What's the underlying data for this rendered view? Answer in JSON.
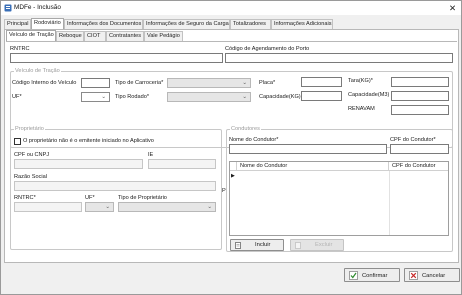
{
  "window": {
    "title": "MDFe - Inclusão",
    "close_glyph": "✕",
    "icon": "app-icon"
  },
  "main_tabs": [
    {
      "label": "Principal"
    },
    {
      "label": "Rodoviário"
    },
    {
      "label": "Informações dos Documentos"
    },
    {
      "label": "Informações de Seguro da Carga"
    },
    {
      "label": "Totalizadores"
    },
    {
      "label": "Informações Adicionais"
    }
  ],
  "sub_tabs": [
    {
      "label": "Veículo de Tração"
    },
    {
      "label": "Reboque"
    },
    {
      "label": "CIOT"
    },
    {
      "label": "Contratantes"
    },
    {
      "label": "Vale Pedágio"
    }
  ],
  "top_fields": {
    "rntrc": "RNTRC",
    "codigo_agendamento": "Código de Agendamento do Porto"
  },
  "veiculo_tracao": {
    "title": "Veículo de Tração",
    "codigo_interno": "Código Interno do Veículo",
    "tipo_carroceria": "Tipo de Carroceria*",
    "placa": "Placa*",
    "tara": "Tara(KG)*",
    "uf": "UF*",
    "tipo_rodado": "Tipo Rodado*",
    "capacidade_kg": "Capacidade(KG)",
    "capacidade_m3": "Capacidade(M3)",
    "renavam": "RENAVAM"
  },
  "proprietario": {
    "title": "Proprietário",
    "checkbox_label": "O proprietário não é o emitente iniciado no Aplicativo",
    "cpf_cnpj": "CPF ou CNPJ",
    "ie": "IE",
    "razao_social": "Razão Social",
    "rntrc": "RNTRC*",
    "uf": "UF*",
    "tipo_proprietario": "Tipo de Proprietário",
    "edge_mark": "P"
  },
  "condutores": {
    "title": "Condutores",
    "nome_condutor": "Nome do Condutor*",
    "cpf_condutor": "CPF do Condutor*",
    "grid_headers": [
      "Nome do Condutor",
      "CPF do Condutor"
    ],
    "row_indicator": "▶",
    "incluir_label": "Incluir",
    "excluir_label": "Excluir"
  },
  "footer": {
    "confirmar": "Confirmar",
    "cancelar": "Cancelar"
  },
  "colors": {
    "accent_green": "#2e8b2e",
    "accent_red": "#c62828",
    "tab_selected": "#ffffff"
  }
}
